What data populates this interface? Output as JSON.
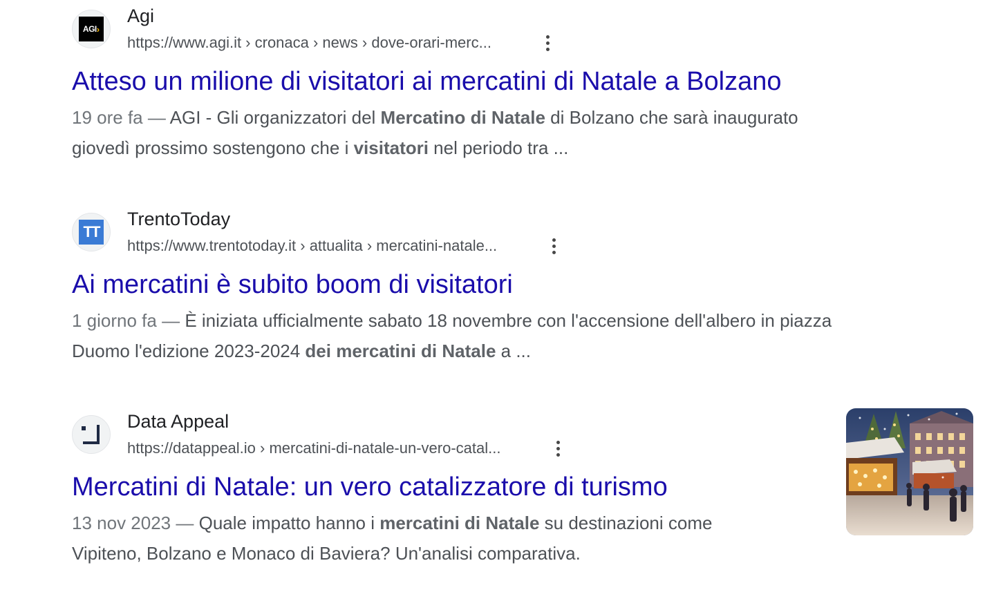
{
  "results": [
    {
      "site_name": "Agi",
      "url": "https://www.agi.it › cronaca › news › dove-orari-merc...",
      "favicon_text": "AGI",
      "title": "Atteso un milione di visitatori ai mercatini di Natale a Bolzano",
      "date": "19 ore fa",
      "dash": " — ",
      "snippet_line1_a": "AGI - Gli organizzatori del ",
      "snippet_line1_bold": "Mercatino di Natale",
      "snippet_line1_b": " di Bolzano che sarà inaugurato",
      "snippet_line2_a": "giovedì prossimo sostengono che i ",
      "snippet_line2_bold": "visitatori",
      "snippet_line2_b": " nel periodo tra ..."
    },
    {
      "site_name": "TrentoToday",
      "url": "https://www.trentotoday.it › attualita › mercatini-natale...",
      "favicon_text": "TT",
      "title": "Ai mercatini è subito boom di visitatori",
      "date": "1 giorno fa",
      "dash": " — ",
      "snippet_line1_a": "È iniziata ufficialmente sabato 18 novembre con l'accensione dell'albero in piazza",
      "snippet_line2_a": "Duomo l'edizione 2023-2024 ",
      "snippet_line2_bold": "dei mercatini di Natale",
      "snippet_line2_b": " a ..."
    },
    {
      "site_name": "Data Appeal",
      "url": "https://datappeal.io › mercatini-di-natale-un-vero-catal...",
      "title": "Mercatini di Natale: un vero catalizzatore di turismo",
      "date": "13 nov 2023",
      "dash": " — ",
      "snippet_line1_a": "Quale impatto hanno i ",
      "snippet_line1_bold": "mercatini di Natale",
      "snippet_line1_b": " su destinazioni come",
      "snippet_line2_a": "Vipiteno, Bolzano e Monaco di Baviera? Un'analisi comparativa.",
      "thumbnail": "christmas-market-photo"
    }
  ],
  "colors": {
    "link": "#1a0dab",
    "site_name": "#202124",
    "url": "#4d5156",
    "snippet": "#4d5156",
    "date": "#70757a"
  },
  "icons": {
    "more": "three-dots-vertical-icon"
  }
}
